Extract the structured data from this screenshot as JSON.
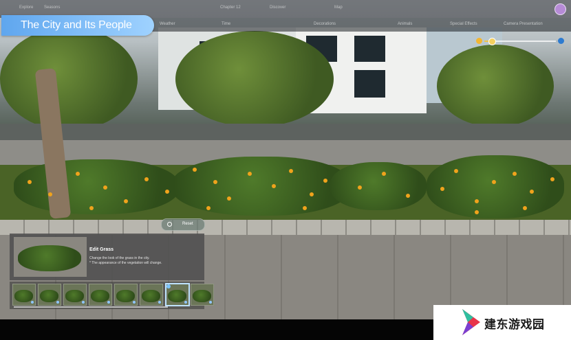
{
  "app": {
    "title": "The City and Its People"
  },
  "top_bar": {
    "items": [
      "Explore",
      "Seasons",
      "Chapter 12",
      "Discover",
      "Map"
    ]
  },
  "sub_bar": {
    "tabs": [
      "Weather",
      "Time",
      "Decorations",
      "Animals",
      "Special Effects",
      "Camera Presentation"
    ]
  },
  "reset": {
    "label": "Reset"
  },
  "edit_panel": {
    "heading": "Edit Grass",
    "description_line1": "Change the look of the grass in the city.",
    "description_line2": "* The appearance of the vegetation will change."
  },
  "time_slider": {
    "value": 0.1
  },
  "options": {
    "count": 8,
    "selected_index": 6
  },
  "watermark": {
    "text": "建东游戏园"
  },
  "colors": {
    "title_pill": "#6fb1f0",
    "flowers": "#f0a31c",
    "selection": "#bfe3ff"
  }
}
